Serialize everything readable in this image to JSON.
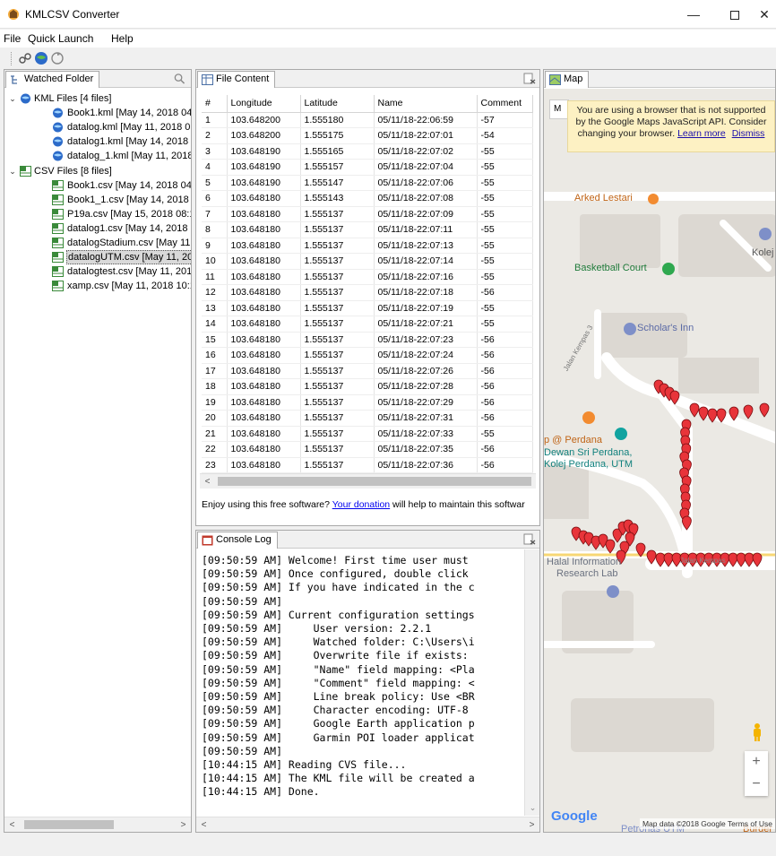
{
  "window": {
    "title": "KMLCSV Converter",
    "minimize": "—",
    "close": "✕"
  },
  "menu": [
    "File",
    "Quick Launch",
    "Help"
  ],
  "watched_folder": {
    "tab_label": "Watched Folder",
    "groups": [
      {
        "label": "KML Files [4 files]",
        "files": [
          "Book1.kml [May 14, 2018 04:",
          "datalog.kml [May 11, 2018 0",
          "datalog1.kml [May 14, 2018 (",
          "datalog_1.kml [May 11, 2018"
        ]
      },
      {
        "label": "CSV Files [8 files]",
        "files": [
          "Book1.csv [May 14, 2018 04:",
          "Book1_1.csv [May 14, 2018 0",
          "P19a.csv [May 15, 2018 08:10",
          "datalog1.csv [May 14, 2018 (",
          "datalogStadium.csv [May 11",
          "datalogUTM.csv [May 11, 20",
          "datalogtest.csv [May 11, 201",
          "xamp.csv [May 11, 2018 10:1"
        ]
      }
    ],
    "selected_file": "datalogUTM.csv [May 11, 20"
  },
  "file_content": {
    "tab_label": "File Content",
    "columns": [
      "#",
      "Longitude",
      "Latitude",
      "Name",
      "Comment"
    ],
    "rows": [
      [
        "1",
        "103.648200",
        "1.555180",
        "05/11/18-22:06:59",
        "-57"
      ],
      [
        "2",
        "103.648200",
        "1.555175",
        "05/11/18-22:07:01",
        "-54"
      ],
      [
        "3",
        "103.648190",
        "1.555165",
        "05/11/18-22:07:02",
        "-55"
      ],
      [
        "4",
        "103.648190",
        "1.555157",
        "05/11/18-22:07:04",
        "-55"
      ],
      [
        "5",
        "103.648190",
        "1.555147",
        "05/11/18-22:07:06",
        "-55"
      ],
      [
        "6",
        "103.648180",
        "1.555143",
        "05/11/18-22:07:08",
        "-55"
      ],
      [
        "7",
        "103.648180",
        "1.555137",
        "05/11/18-22:07:09",
        "-55"
      ],
      [
        "8",
        "103.648180",
        "1.555137",
        "05/11/18-22:07:11",
        "-55"
      ],
      [
        "9",
        "103.648180",
        "1.555137",
        "05/11/18-22:07:13",
        "-55"
      ],
      [
        "10",
        "103.648180",
        "1.555137",
        "05/11/18-22:07:14",
        "-55"
      ],
      [
        "11",
        "103.648180",
        "1.555137",
        "05/11/18-22:07:16",
        "-55"
      ],
      [
        "12",
        "103.648180",
        "1.555137",
        "05/11/18-22:07:18",
        "-56"
      ],
      [
        "13",
        "103.648180",
        "1.555137",
        "05/11/18-22:07:19",
        "-55"
      ],
      [
        "14",
        "103.648180",
        "1.555137",
        "05/11/18-22:07:21",
        "-55"
      ],
      [
        "15",
        "103.648180",
        "1.555137",
        "05/11/18-22:07:23",
        "-56"
      ],
      [
        "16",
        "103.648180",
        "1.555137",
        "05/11/18-22:07:24",
        "-56"
      ],
      [
        "17",
        "103.648180",
        "1.555137",
        "05/11/18-22:07:26",
        "-56"
      ],
      [
        "18",
        "103.648180",
        "1.555137",
        "05/11/18-22:07:28",
        "-56"
      ],
      [
        "19",
        "103.648180",
        "1.555137",
        "05/11/18-22:07:29",
        "-56"
      ],
      [
        "20",
        "103.648180",
        "1.555137",
        "05/11/18-22:07:31",
        "-56"
      ],
      [
        "21",
        "103.648180",
        "1.555137",
        "05/11/18-22:07:33",
        "-55"
      ],
      [
        "22",
        "103.648180",
        "1.555137",
        "05/11/18-22:07:35",
        "-56"
      ],
      [
        "23",
        "103.648180",
        "1.555137",
        "05/11/18-22:07:36",
        "-56"
      ]
    ],
    "donation_prefix": "Enjoy using this free software? ",
    "donation_link": "Your donation",
    "donation_suffix": " will help to maintain this softwar"
  },
  "console": {
    "tab_label": "Console Log",
    "lines": [
      "[09:50:59 AM] Welcome! First time user must",
      "[09:50:59 AM] Once configured, double click",
      "[09:50:59 AM] If you have indicated in the c",
      "[09:50:59 AM]",
      "[09:50:59 AM] Current configuration settings",
      "[09:50:59 AM]     User version: 2.2.1",
      "[09:50:59 AM]     Watched folder: C:\\Users\\i",
      "[09:50:59 AM]     Overwrite file if exists:",
      "[09:50:59 AM]     \"Name\" field mapping: <Pla",
      "[09:50:59 AM]     \"Comment\" field mapping: <",
      "[09:50:59 AM]     Line break policy: Use <BR",
      "[09:50:59 AM]     Character encoding: UTF-8",
      "[09:50:59 AM]     Google Earth application p",
      "[09:50:59 AM]     Garmin POI loader applicat",
      "[09:50:59 AM]",
      "[10:44:15 AM] Reading CVS file...",
      "[10:44:15 AM] The KML file will be created a",
      "[10:44:15 AM] Done."
    ]
  },
  "map": {
    "tab_label": "Map",
    "warning_text": "You are using a browser that is not supported by the Google Maps JavaScript API. Consider changing your browser.",
    "learn_more": "Learn more",
    "dismiss": "Dismiss",
    "map_type_label": "M",
    "labels": {
      "arked_lestari": "Arked Lestari",
      "basketball": "Basketball Court",
      "scholars_inn": "Scholar's Inn",
      "kolej": "Kolej",
      "jalan_kempas_3": "Jalan Kempas 3",
      "perdana": "p @ Perdana",
      "dewan": "Dewan Sri Perdana,",
      "kolej_perdana": "Kolej Perdana, UTM",
      "halal1": "Halal Information",
      "halal2": "Research Lab",
      "jalan_kempas": "Jalan Kempas",
      "petronas": "Petronas UTM",
      "burger": "Burger"
    },
    "google": "Google",
    "attribution": "Map data ©2018 Google   Terms of Use",
    "zoom_in": "+",
    "zoom_out": "−",
    "marker_color": "#e8343a"
  }
}
